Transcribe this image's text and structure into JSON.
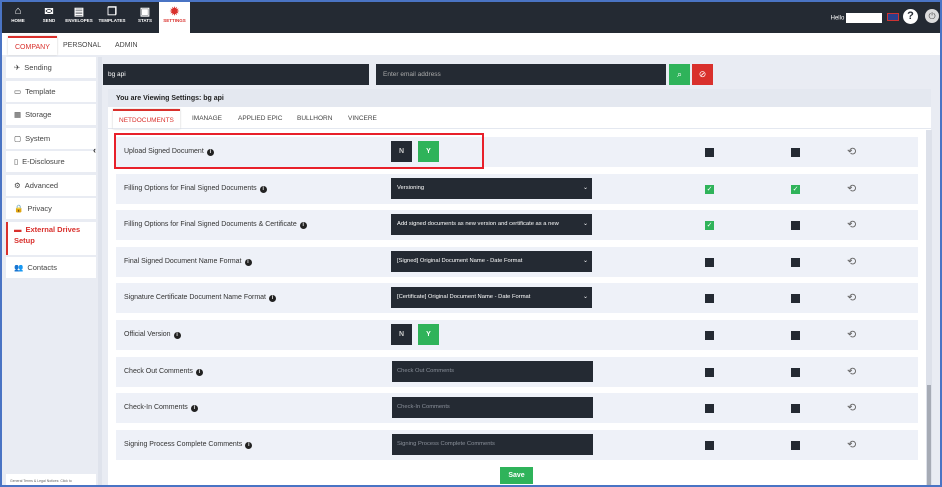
{
  "topnav": [
    {
      "label": "HOME",
      "icon": "home-icon",
      "glyph": "⌂"
    },
    {
      "label": "SEND",
      "icon": "envelope-icon",
      "glyph": "✉"
    },
    {
      "label": "ENVELOPES",
      "icon": "inbox-icon",
      "glyph": "▤"
    },
    {
      "label": "TEMPLATES",
      "icon": "templates-icon",
      "glyph": "❐"
    },
    {
      "label": "STATS",
      "icon": "briefcase-icon",
      "glyph": "▣"
    },
    {
      "label": "SETTINGS",
      "icon": "gear-icon",
      "glyph": "✹"
    }
  ],
  "header": {
    "hello": "Hello",
    "help": "?",
    "power": "⏻"
  },
  "subtabs": [
    "COMPANY",
    "PERSONAL",
    "ADMIN"
  ],
  "sidebar": [
    {
      "label": "Sending",
      "glyph": "✈"
    },
    {
      "label": "Template",
      "glyph": "▭"
    },
    {
      "label": "Storage",
      "glyph": "▦"
    },
    {
      "label": "System",
      "glyph": "▢"
    },
    {
      "label": "E-Disclosure",
      "glyph": "▯"
    },
    {
      "label": "Advanced",
      "glyph": "⚙"
    },
    {
      "label": "Privacy",
      "glyph": "🔒"
    },
    {
      "label": "External Drives Setup",
      "glyph": "▬"
    },
    {
      "label": "Contacts",
      "glyph": "👥"
    }
  ],
  "sidebar_footer": "General Terms & Legal Notices: Click to",
  "search": {
    "name": "bg api",
    "email_placeholder": "Enter email address"
  },
  "panel": {
    "heading": "You are Viewing Settings: bg api",
    "tabs": [
      "NETDOCUMENTS",
      "IMANAGE",
      "APPLIED EPIC",
      "BULLHORN",
      "VINCERE"
    ]
  },
  "rows": [
    {
      "label": "Upload Signed Document",
      "type": "yn",
      "n": "N",
      "y": "Y",
      "c1": false,
      "c2": false
    },
    {
      "label": "Filling Options for Final Signed Documents",
      "type": "select",
      "value": "Versioning",
      "c1": true,
      "c2": true
    },
    {
      "label": "Filling Options for Final Signed Documents & Certificate",
      "type": "select",
      "value": "Add signed documents as new version and certificate as a new",
      "c1": true,
      "c2": false
    },
    {
      "label": "Final Signed Document Name Format",
      "type": "select",
      "value": "[Signed] Original Document Name - Date Format",
      "c1": false,
      "c2": false
    },
    {
      "label": "Signature Certificate Document Name Format",
      "type": "select",
      "value": "[Certificate] Original Document Name - Date Format",
      "c1": false,
      "c2": false
    },
    {
      "label": "Official Version",
      "type": "yn",
      "n": "N",
      "y": "Y",
      "c1": false,
      "c2": false
    },
    {
      "label": "Check Out Comments",
      "type": "text",
      "placeholder": "Check Out Comments",
      "c1": false,
      "c2": false
    },
    {
      "label": "Check-In Comments",
      "type": "text",
      "placeholder": "Check-In Comments",
      "c1": false,
      "c2": false
    },
    {
      "label": "Signing Process Complete Comments",
      "type": "text",
      "placeholder": "Signing Process Complete Comments",
      "c1": false,
      "c2": false
    }
  ],
  "save_label": "Save",
  "colors": {
    "accent": "#d9302c",
    "green": "#2fb35a",
    "dark": "#242a33"
  }
}
